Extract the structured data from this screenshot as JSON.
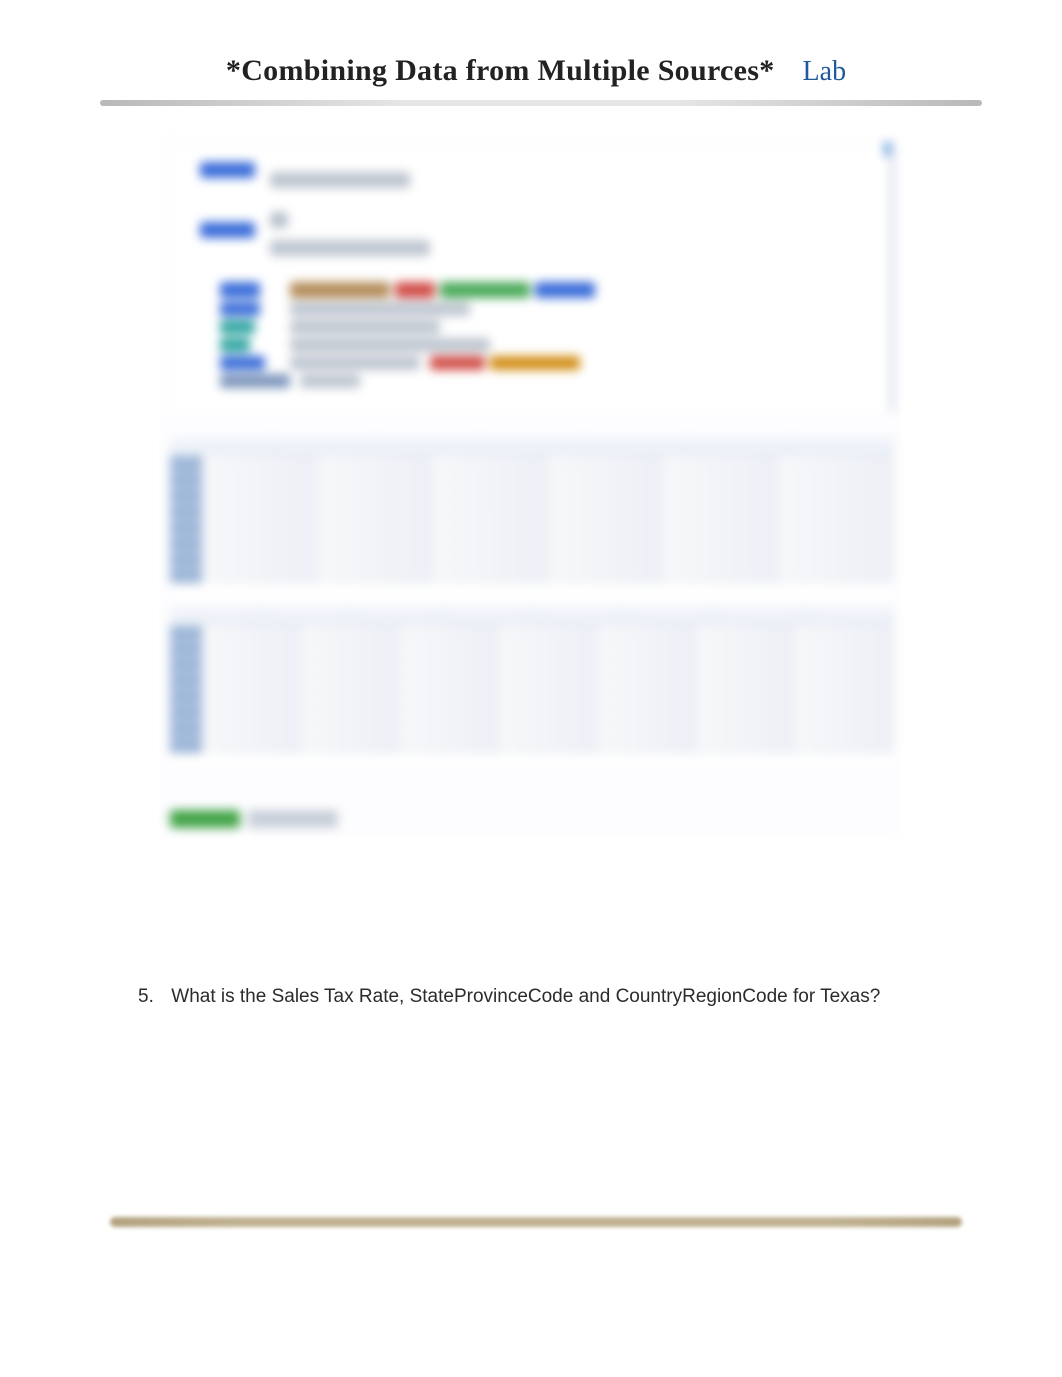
{
  "header": {
    "title": "*Combining Data from Multiple Sources*",
    "badge": "Lab"
  },
  "question": {
    "number": "5.",
    "text": "What is the Sales Tax Rate, StateProvinceCode and CountryRegionCode for Texas?"
  }
}
